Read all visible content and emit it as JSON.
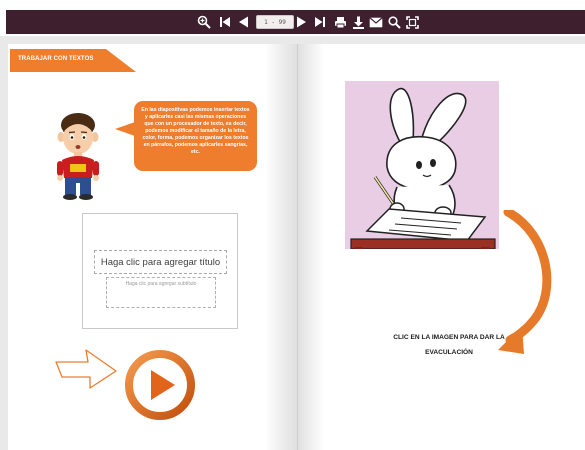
{
  "toolbar": {
    "page_indicator": "1 - 99",
    "buttons": [
      {
        "name": "zoom-in-icon"
      },
      {
        "name": "first-page-icon"
      },
      {
        "name": "previous-page-icon"
      },
      {
        "name": "next-page-icon"
      },
      {
        "name": "last-page-icon"
      },
      {
        "name": "print-icon"
      },
      {
        "name": "download-icon"
      },
      {
        "name": "email-icon"
      },
      {
        "name": "search-icon"
      },
      {
        "name": "fullscreen-icon"
      }
    ]
  },
  "left_page": {
    "section_tab": "TRABAJAR CON TEXTOS",
    "speech_text": "En las diapositivas podemos insertar textos y aplicarles casi las mismas operaciones que con un procesador de texto, es decir, podemos modificar el tamaño de la letra, color, forma, podemos organizar los textos en párrafos, podemos aplicarles sangrías, etc.",
    "slide_title": "Haga clic para agregar título",
    "slide_subtitle": "Haga clic para agregar subtítulo"
  },
  "right_page": {
    "eval_line1": "CLIC EN LA IMAGEN PARA DAR LA",
    "eval_line2": "EVACULACIÓN"
  },
  "colors": {
    "toolbar": "#3d1f2e",
    "accent_orange": "#ee7d2e",
    "image_bg": "#e8cde5"
  }
}
